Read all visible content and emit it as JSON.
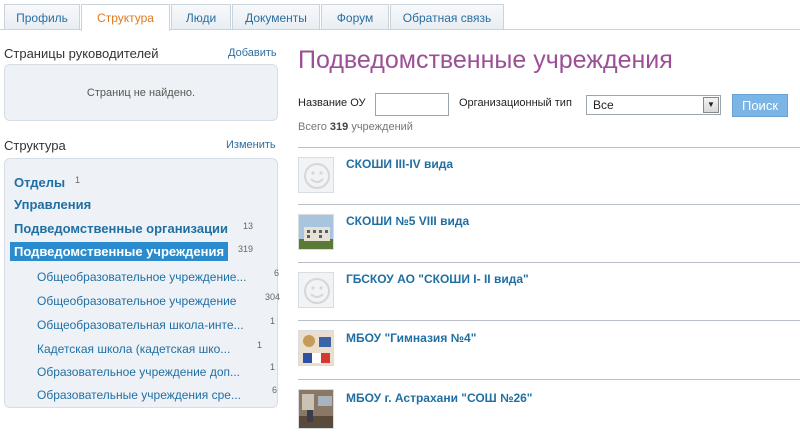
{
  "tabs": [
    {
      "label": "Профиль"
    },
    {
      "label": "Структура"
    },
    {
      "label": "Люди"
    },
    {
      "label": "Документы"
    },
    {
      "label": "Форум"
    },
    {
      "label": "Обратная связь"
    }
  ],
  "sidebar": {
    "managers_title": "Страницы руководителей",
    "managers_add": "Добавить",
    "managers_empty": "Страниц не найдено.",
    "structure_title": "Структура",
    "structure_edit": "Изменить",
    "items": [
      {
        "label": "Отделы",
        "count": "1"
      },
      {
        "label": "Управления",
        "count": ""
      },
      {
        "label": "Подведомственные организации",
        "count": "13"
      },
      {
        "label": "Подведомственные учреждения",
        "count": "319"
      }
    ],
    "subitems": [
      {
        "label": "Общеобразовательное учреждение...",
        "count": "6"
      },
      {
        "label": "Общеобразовательное учреждение",
        "count": "304"
      },
      {
        "label": "Общеобразовательная школа-инте...",
        "count": "1"
      },
      {
        "label": "Кадетская школа (кадетская шко...",
        "count": "1"
      },
      {
        "label": "Образовательное учреждение доп...",
        "count": "1"
      },
      {
        "label": "Образовательные учреждения сре...",
        "count": "6"
      }
    ]
  },
  "main": {
    "title": "Подведомственные учреждения",
    "filter_name_label": "Название ОУ",
    "filter_name_value": "",
    "filter_type_label": "Организационный тип",
    "filter_type_value": "Все",
    "search_button": "Поиск",
    "total_prefix": "Всего",
    "total_count": "319",
    "total_suffix": "учреждений",
    "results": [
      {
        "title": "СКОШИ III-IV вида",
        "thumb": "smiley"
      },
      {
        "title": "СКОШИ №5 VIII вида",
        "thumb": "building-photo"
      },
      {
        "title": "ГБСКОУ АО \"СКОШИ I- II вида\"",
        "thumb": "smiley"
      },
      {
        "title": "МБОУ \"Гимназия №4\"",
        "thumb": "flag-photo"
      },
      {
        "title": "МБОУ г. Астрахани \"СОШ №26\"",
        "thumb": "room-photo"
      }
    ]
  },
  "colors": {
    "link": "#1f6fa3",
    "active_tab": "#e07a1f",
    "title": "#9b4f96",
    "selected_item": "#2a8ccf",
    "search_button": "#7ab5e5"
  }
}
